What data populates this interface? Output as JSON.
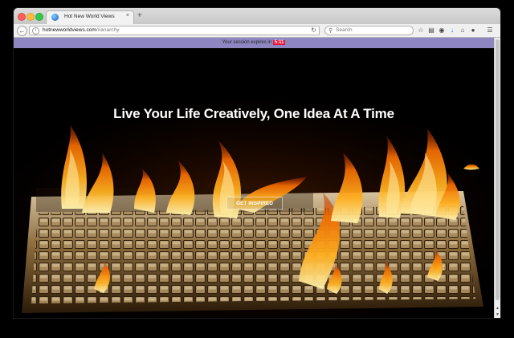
{
  "browser": {
    "tab": {
      "title": "Hot New World Views",
      "favicon": "globe-icon",
      "close_glyph": "×"
    },
    "new_tab_glyph": "+",
    "url": {
      "domain": "hotnewworldviews.com",
      "path": "/#anarchy"
    },
    "search": {
      "placeholder": "Search"
    },
    "toolbar_icons": [
      "star-icon",
      "reading-list-icon",
      "pocket-icon",
      "download-icon",
      "home-icon",
      "chat-icon",
      "menu-icon"
    ]
  },
  "session_banner": {
    "prefix": "Your session expires in",
    "timer": "5:11",
    "background": "#8e86c1",
    "timer_color": "#e8143b"
  },
  "hero": {
    "headline": "Live Your Life Creatively, One Idea At A Time",
    "cta_label": "GET INSPIRED",
    "background_image": "keyboard-on-fire"
  }
}
